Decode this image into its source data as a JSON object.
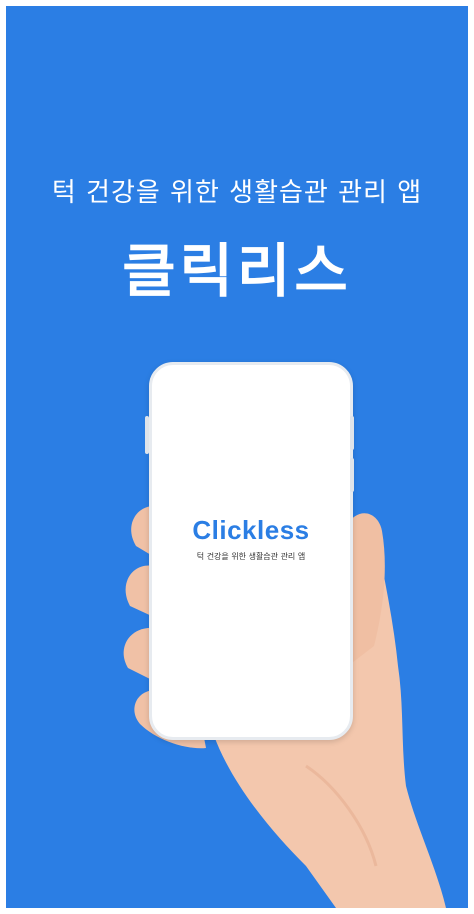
{
  "splash": {
    "subtitle": "턱 건강을 위한 생활습관 관리 앱",
    "title": "클릭리스"
  },
  "phone_screen": {
    "logo_text": "Clickless",
    "logo_subtitle": "턱 건강을 위한 생활습관 관리 앱"
  },
  "colors": {
    "background": "#2b7ee4",
    "brand": "#2b7ee4",
    "text_on_bg": "#ffffff"
  }
}
